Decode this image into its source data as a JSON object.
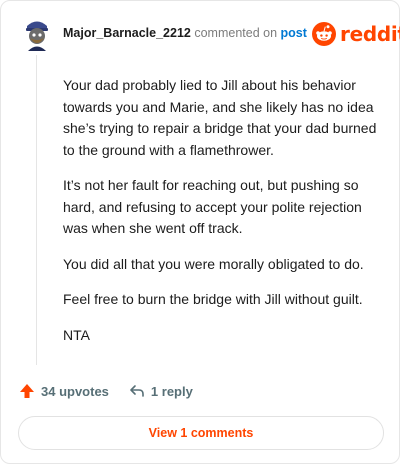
{
  "comment": {
    "username": "Major_Barnacle_2212",
    "commented_on_text": "commented on",
    "post_link_text": "post",
    "paragraphs": [
      "Your dad probably lied to Jill about his behavior towards you and Marie, and she likely has no idea she’s trying to repair a bridge that your dad burned to the ground with a flamethrower.",
      "It’s not her fault for reaching out, but pushing so hard, and refusing to accept your polite rejection was when she went off track.",
      "You did all that you were morally obligated to do.",
      "Feel free to burn the bridge with Jill without guilt.",
      "NTA"
    ],
    "upvotes_label": "34 upvotes",
    "replies_label": "1 reply",
    "view_comments_label": "View 1 comments"
  },
  "brand": {
    "wordmark": "reddit",
    "color": "#ff4500"
  },
  "icons": {
    "upvote": "arrow-up-icon",
    "reply": "reply-arrow-icon",
    "logo": "reddit-snoo-icon"
  }
}
